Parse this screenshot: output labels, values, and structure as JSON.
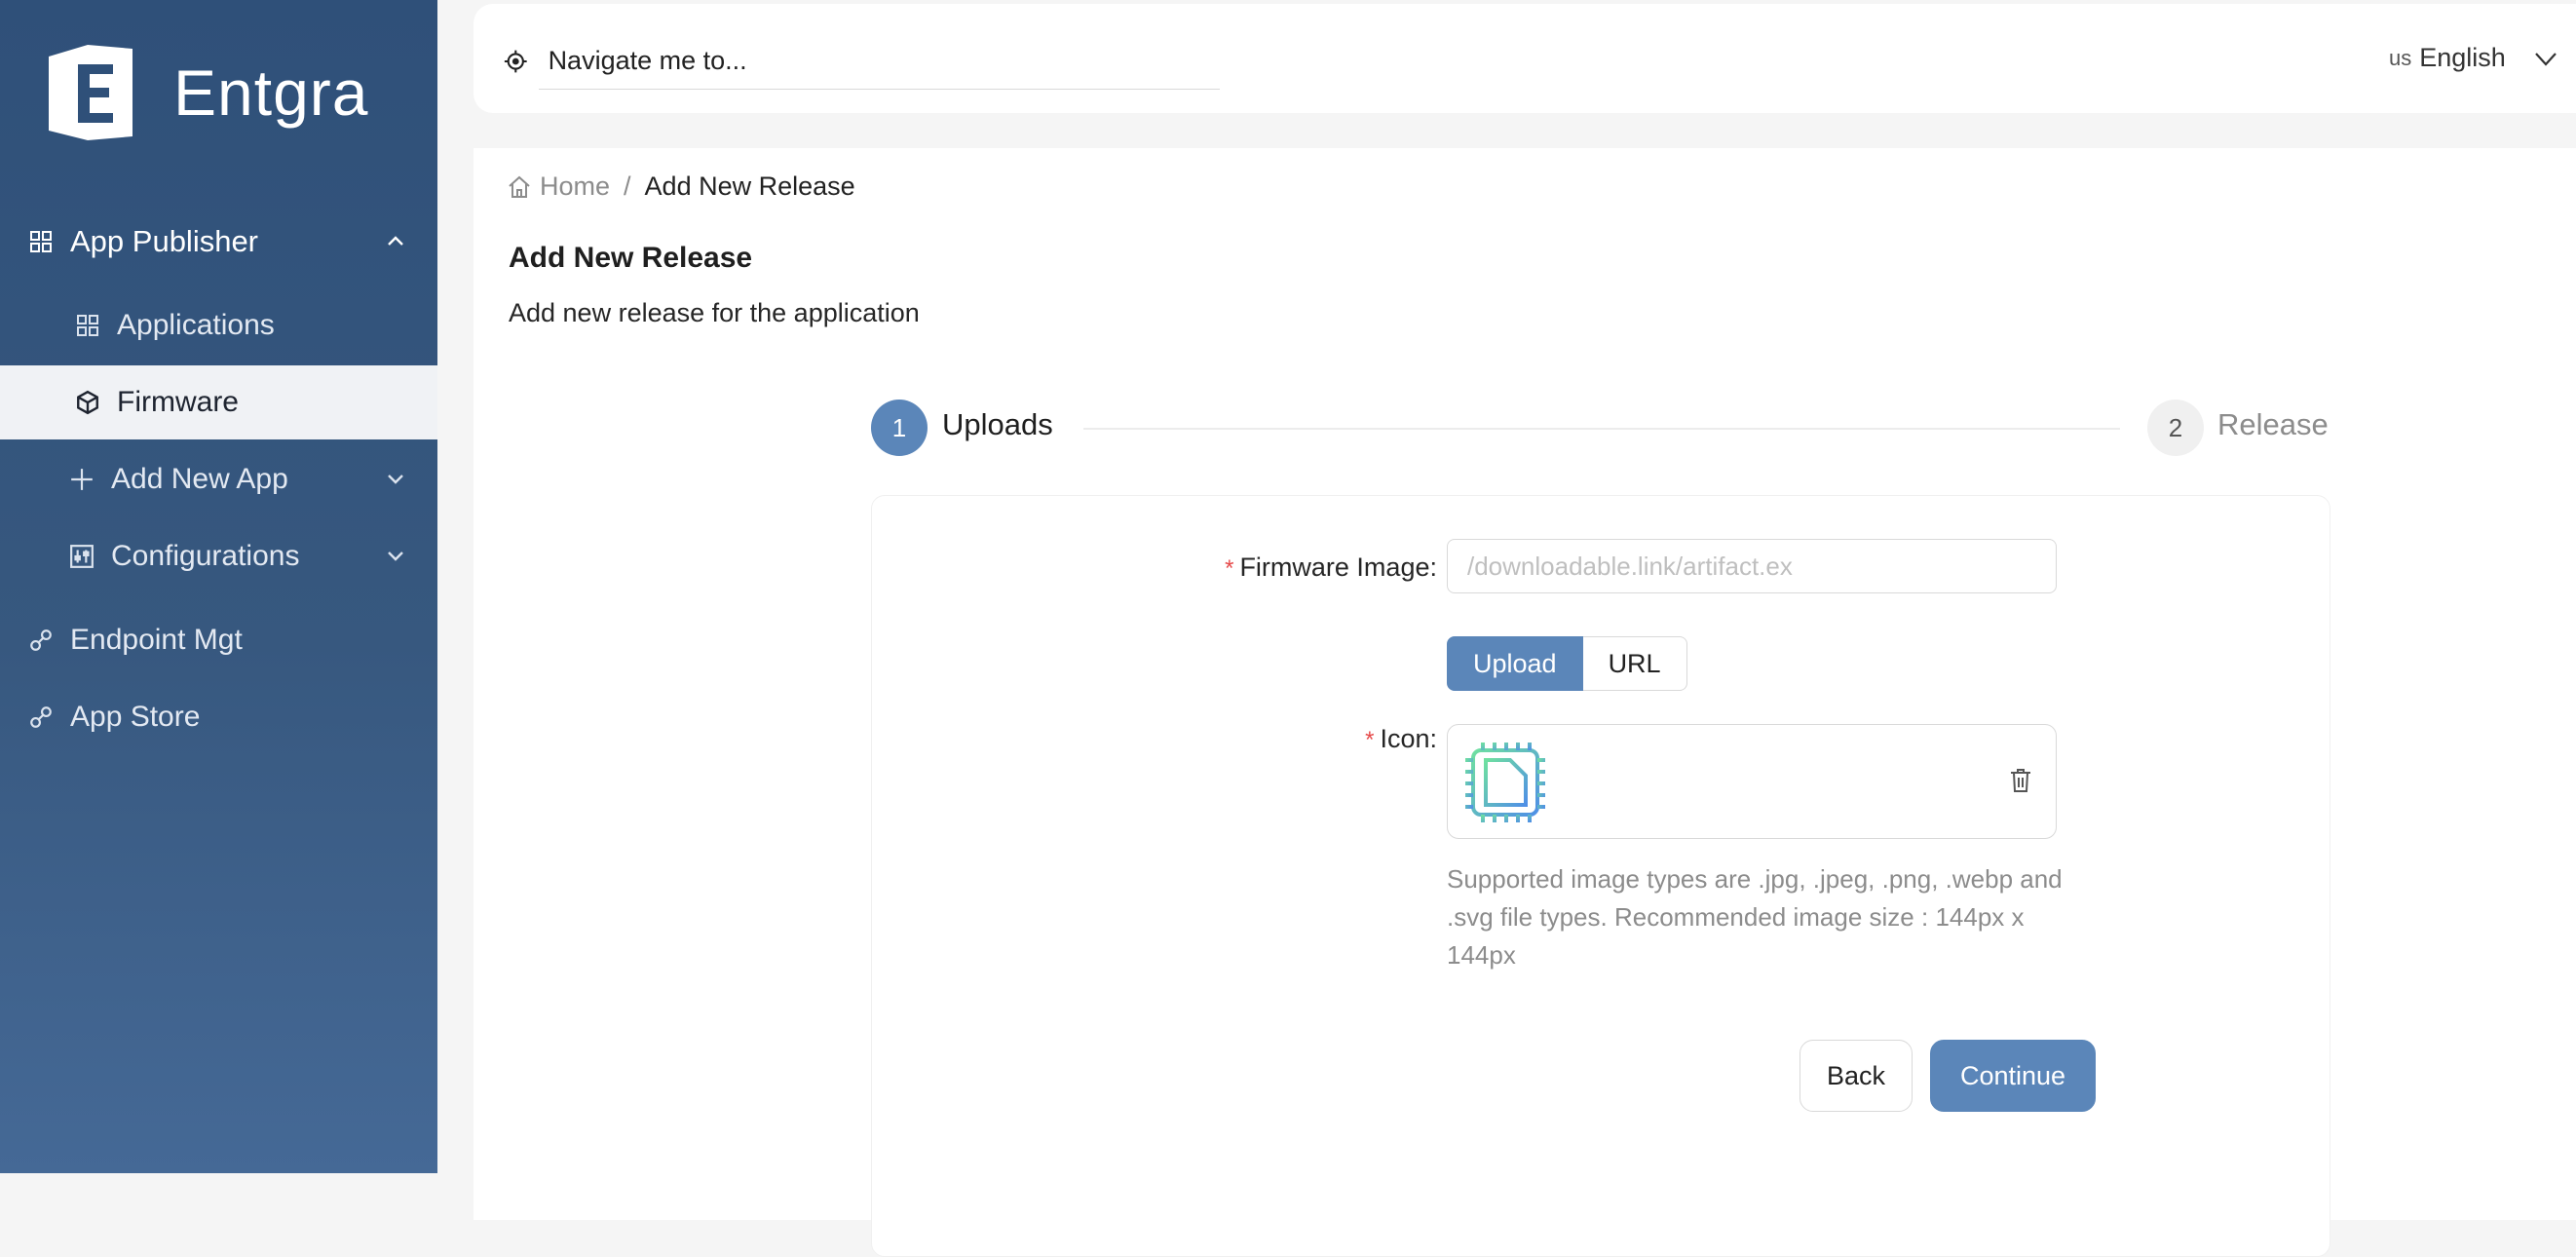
{
  "app": {
    "logo_text": "Entgra"
  },
  "sidebar": {
    "items": [
      {
        "label": "App Publisher",
        "icon": "grid-icon"
      },
      {
        "label": "Applications",
        "icon": "grid-icon"
      },
      {
        "label": "Firmware",
        "icon": "cube-icon",
        "selected": true
      },
      {
        "label": "Add New App",
        "icon": "plus-icon"
      },
      {
        "label": "Configurations",
        "icon": "sliders-icon"
      },
      {
        "label": "Endpoint Mgt",
        "icon": "link-icon"
      },
      {
        "label": "App Store",
        "icon": "link-icon"
      }
    ]
  },
  "topbar": {
    "search_placeholder": "Navigate me to...",
    "language_flag": "us",
    "language": "English"
  },
  "breadcrumb": {
    "home": "Home",
    "separator": "/",
    "current": "Add New Release"
  },
  "page": {
    "title": "Add New Release",
    "subtitle": "Add new release for the application"
  },
  "steps": [
    {
      "number": "1",
      "label": "Uploads",
      "active": true
    },
    {
      "number": "2",
      "label": "Release",
      "active": false
    }
  ],
  "form": {
    "firmware_label": "Firmware Image",
    "firmware_placeholder": "/downloadable.link/artifact.ex",
    "upload_label": "Upload",
    "url_label": "URL",
    "icon_label": "Icon",
    "required_mark": "*",
    "colon": ":",
    "hint": "Supported image types are .jpg, .jpeg, .png, .webp and .svg file types. Recommended image size : 144px x 144px",
    "back_label": "Back",
    "continue_label": "Continue"
  },
  "colors": {
    "sidebar_top": "#2f5079",
    "sidebar_bottom": "#456996",
    "accent": "#5b86b9",
    "required": "#e64a4a"
  }
}
